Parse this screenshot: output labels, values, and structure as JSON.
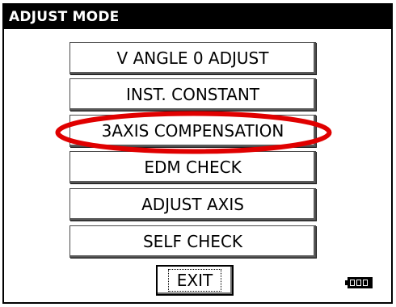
{
  "window": {
    "title": "ADJUST MODE"
  },
  "menu": {
    "items": [
      {
        "label": "V ANGLE 0 ADJUST",
        "name": "v-angle-0-adjust-button"
      },
      {
        "label": "INST. CONSTANT",
        "name": "inst-constant-button"
      },
      {
        "label": "3AXIS COMPENSATION",
        "name": "3axis-compensation-button",
        "highlighted": true
      },
      {
        "label": "EDM CHECK",
        "name": "edm-check-button"
      },
      {
        "label": "ADJUST AXIS",
        "name": "adjust-axis-button"
      },
      {
        "label": "SELF CHECK",
        "name": "self-check-button"
      }
    ]
  },
  "footer": {
    "exit_label": "EXIT",
    "battery_icon": "battery-full-icon"
  },
  "colors": {
    "titlebar_bg": "#000000",
    "titlebar_fg": "#ffffff",
    "highlight": "#e00000"
  }
}
